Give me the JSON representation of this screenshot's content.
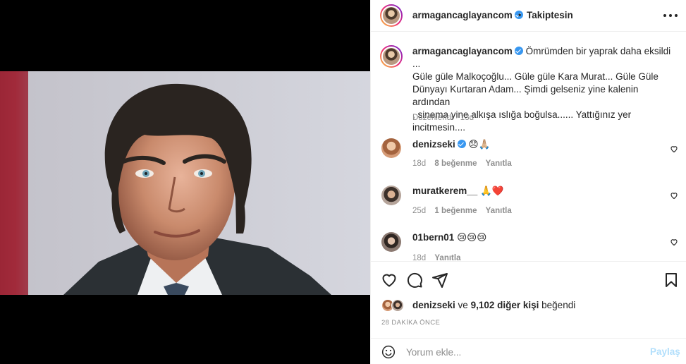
{
  "post": {
    "author": "armagancaglayancom",
    "follow_status": "Takiptesin",
    "dot": "•",
    "caption_lines": [
      "Ömrümden bir yaprak daha eksildi ...",
      "Güle güle Malkoçoğlu... Güle güle Kara Murat... Güle Güle",
      "Dünyayı Kurtaran Adam... Şimdi gelseniz yine kalenin ardından",
      ", sinema yine alkışa ıslığa boğulsa...... Yattığınız yer",
      "incitmesin...."
    ],
    "edited_label": "Düzenlendi",
    "edited_sep": "·",
    "edited_age": "13d"
  },
  "comments": [
    {
      "user": "denizseki",
      "verified": true,
      "text": "😞🙏🏼",
      "age": "18d",
      "likes": "8 beğenme",
      "reply": "Yanıtla"
    },
    {
      "user": "muratkerem__",
      "verified": false,
      "text": "🙏❤️",
      "age": "25d",
      "likes": "1 beğenme",
      "reply": "Yanıtla"
    },
    {
      "user": "01bern01",
      "verified": false,
      "text": "😢😢😢",
      "age": "18d",
      "likes": "",
      "reply": "Yanıtla"
    }
  ],
  "likes": {
    "first_liker": "denizseki",
    "connector": "ve",
    "count": "9,102 diğer kişi",
    "suffix": "beğendi"
  },
  "time_ago": "28 DAKİKA ÖNCE",
  "comment_box": {
    "placeholder": "Yorum ekle...",
    "post_label": "Paylaş"
  },
  "icons": {
    "like": "heart-icon",
    "comment": "comment-icon",
    "share": "share-icon",
    "save": "bookmark-icon",
    "more": "more-options-icon",
    "emoji": "emoji-icon",
    "verified": "verified-badge-icon"
  },
  "colors": {
    "verified": "#3897f0",
    "post_button_disabled": "#b2dffc",
    "muted_text": "#8e8e8e",
    "heart_red": "#ed4956"
  }
}
